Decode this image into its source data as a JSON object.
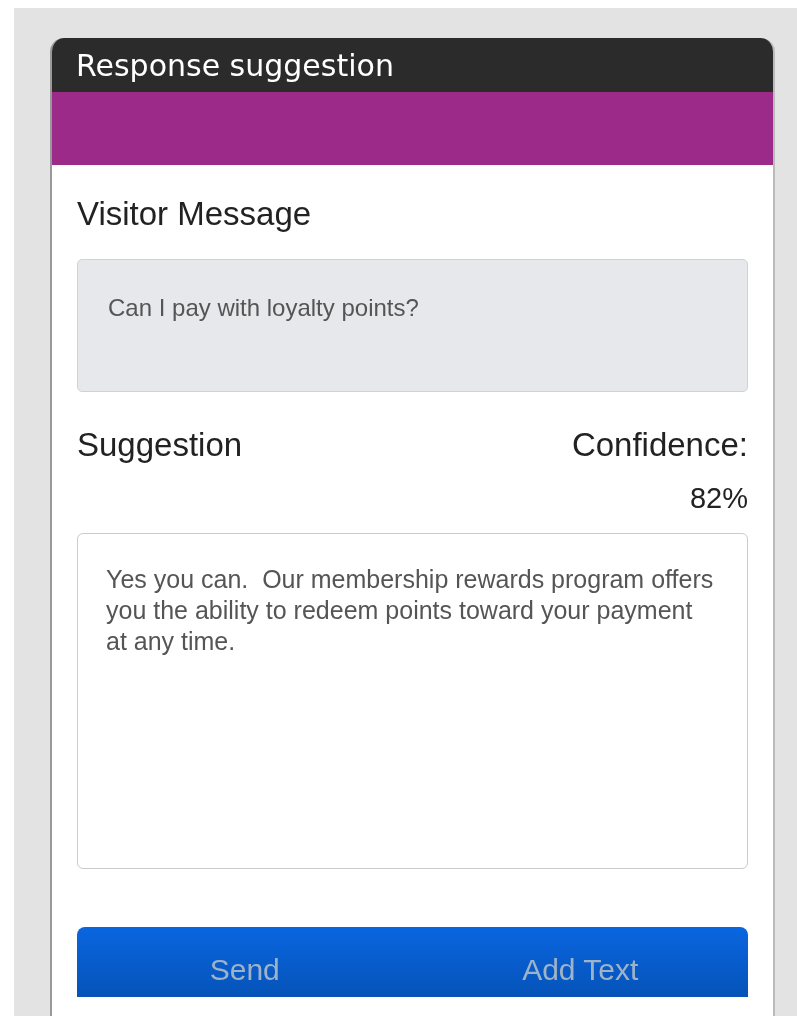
{
  "panel": {
    "title": "Response suggestion"
  },
  "visitor_message": {
    "label": "Visitor Message",
    "value": "Can I pay with loyalty points?"
  },
  "suggestion": {
    "label": "Suggestion",
    "confidence_label": "Confidence:",
    "confidence_value": "82%",
    "value": "Yes you can.  Our membership rewards program offers you the ability to redeem points toward your payment at any time."
  },
  "buttons": [
    "Send",
    "Add Text"
  ]
}
